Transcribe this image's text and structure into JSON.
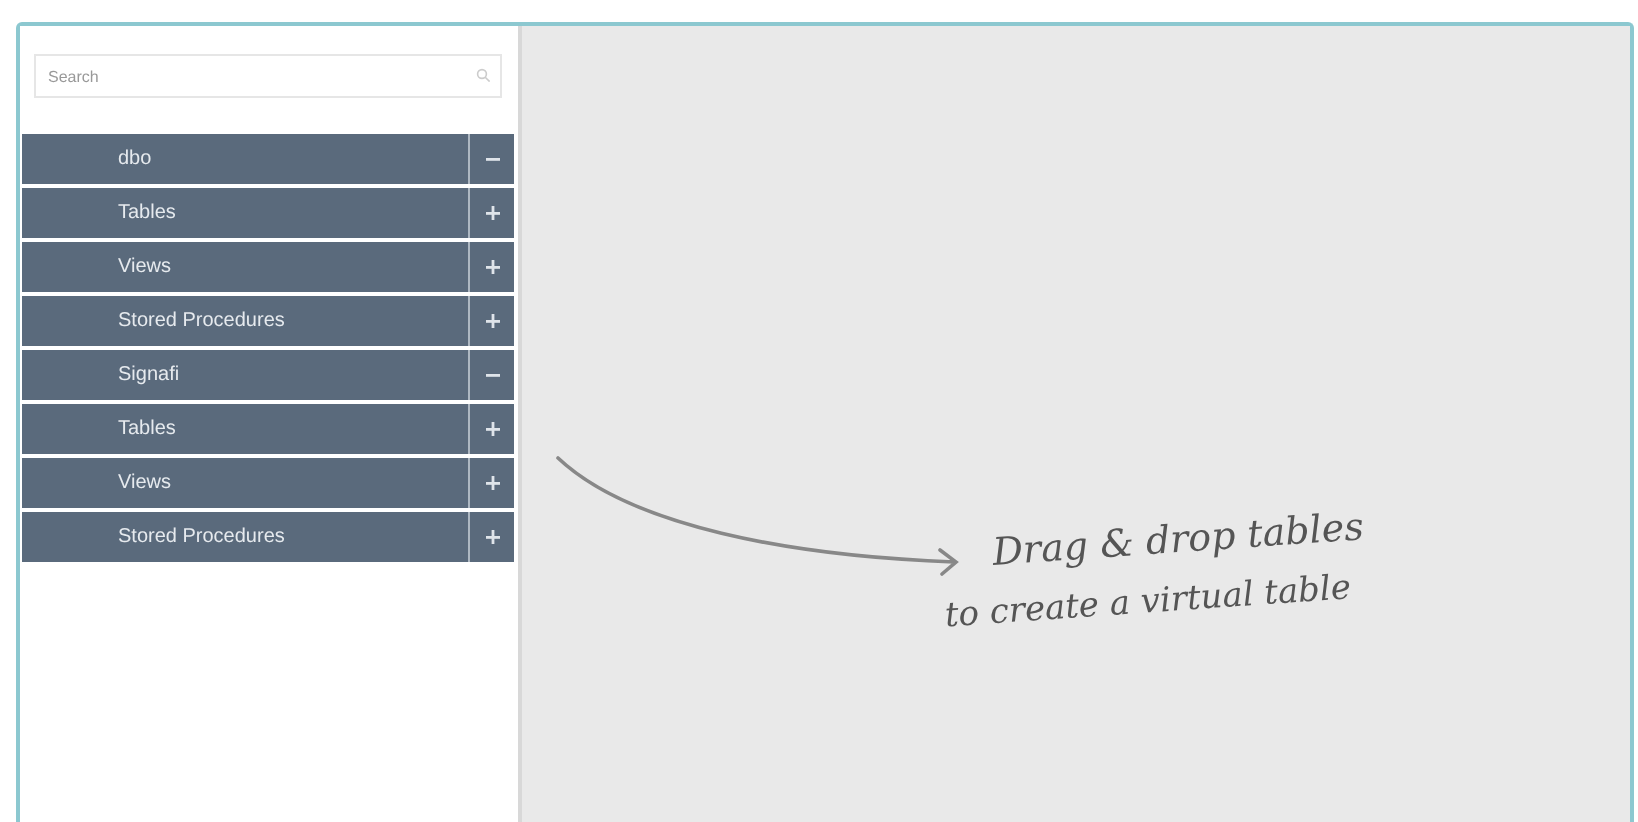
{
  "search": {
    "placeholder": "Search"
  },
  "tree_items": [
    {
      "label": "dbo",
      "expanded": true
    },
    {
      "label": "Tables",
      "expanded": false
    },
    {
      "label": "Views",
      "expanded": false
    },
    {
      "label": "Stored Procedures",
      "expanded": false
    },
    {
      "label": "Signafi",
      "expanded": true
    },
    {
      "label": "Tables",
      "expanded": false
    },
    {
      "label": "Views",
      "expanded": false
    },
    {
      "label": "Stored Procedures",
      "expanded": false
    }
  ],
  "canvas": {
    "hint_lines": [
      "Drag & drop tables",
      "to create a virtual table"
    ]
  }
}
